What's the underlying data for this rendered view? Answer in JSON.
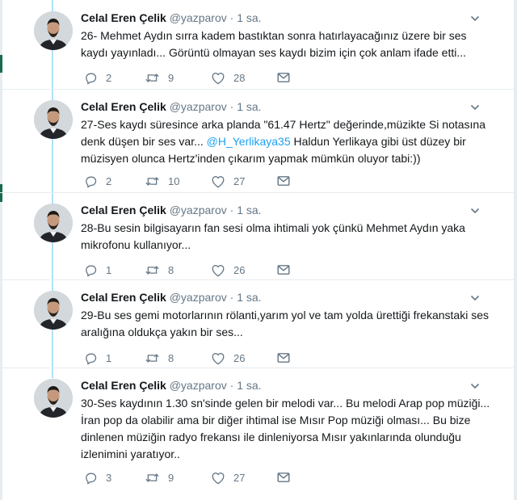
{
  "colors": {
    "accent": "#1da1f2",
    "text": "#14171a",
    "muted": "#657786",
    "thread_line": "#b1e0f7",
    "divider": "#e6ecf0"
  },
  "tweets": [
    {
      "name": "Celal Eren Çelik",
      "handle": "@yazparov",
      "dot": "·",
      "time": "1 sa.",
      "text_before": "26- Mehmet Aydın sırra kadem bastıktan sonra hatırlayacağınız üzere bir ses kaydı yayınladı... Görüntü olmayan ses kaydı bizim için çok anlam ifade etti...",
      "mention": "",
      "text_after": "",
      "replies": "2",
      "retweets": "9",
      "likes": "28"
    },
    {
      "name": "Celal Eren Çelik",
      "handle": "@yazparov",
      "dot": "·",
      "time": "1 sa.",
      "text_before": "27-Ses kaydı süresince arka planda \"61.47 Hertz\" değerinde,müzikte Si notasına denk düşen bir ses var... ",
      "mention": "@H_Yerlikaya35",
      "text_after": "  Haldun Yerlikaya gibi üst düzey bir müzisyen olunca Hertz'inden çıkarım yapmak mümkün oluyor tabi:))",
      "replies": "2",
      "retweets": "10",
      "likes": "27"
    },
    {
      "name": "Celal Eren Çelik",
      "handle": "@yazparov",
      "dot": "·",
      "time": "1 sa.",
      "text_before": "28-Bu sesin bilgisayarın fan sesi olma ihtimali yok çünkü Mehmet Aydın yaka mikrofonu kullanıyor...",
      "mention": "",
      "text_after": "",
      "replies": "1",
      "retweets": "8",
      "likes": "26"
    },
    {
      "name": "Celal Eren Çelik",
      "handle": "@yazparov",
      "dot": "·",
      "time": "1 sa.",
      "text_before": "29-Bu ses gemi motorlarının rölanti,yarım yol ve tam yolda ürettiği frekanstaki ses aralığına oldukça yakın bir ses...",
      "mention": "",
      "text_after": "",
      "replies": "1",
      "retweets": "8",
      "likes": "26"
    },
    {
      "name": "Celal Eren Çelik",
      "handle": "@yazparov",
      "dot": "·",
      "time": "1 sa.",
      "text_before": "30-Ses kaydının 1.30 sn'sinde gelen bir melodi var... Bu melodi Arap pop müziği... İran pop da olabilir ama bir diğer ihtimal ise Mısır Pop müziği olması... Bu bize dinlenen müziğin radyo frekansı ile dinleniyorsa Mısır yakınlarında olunduğu izlenimini yaratıyor..",
      "mention": "",
      "text_after": "",
      "replies": "3",
      "retweets": "9",
      "likes": "27"
    }
  ]
}
